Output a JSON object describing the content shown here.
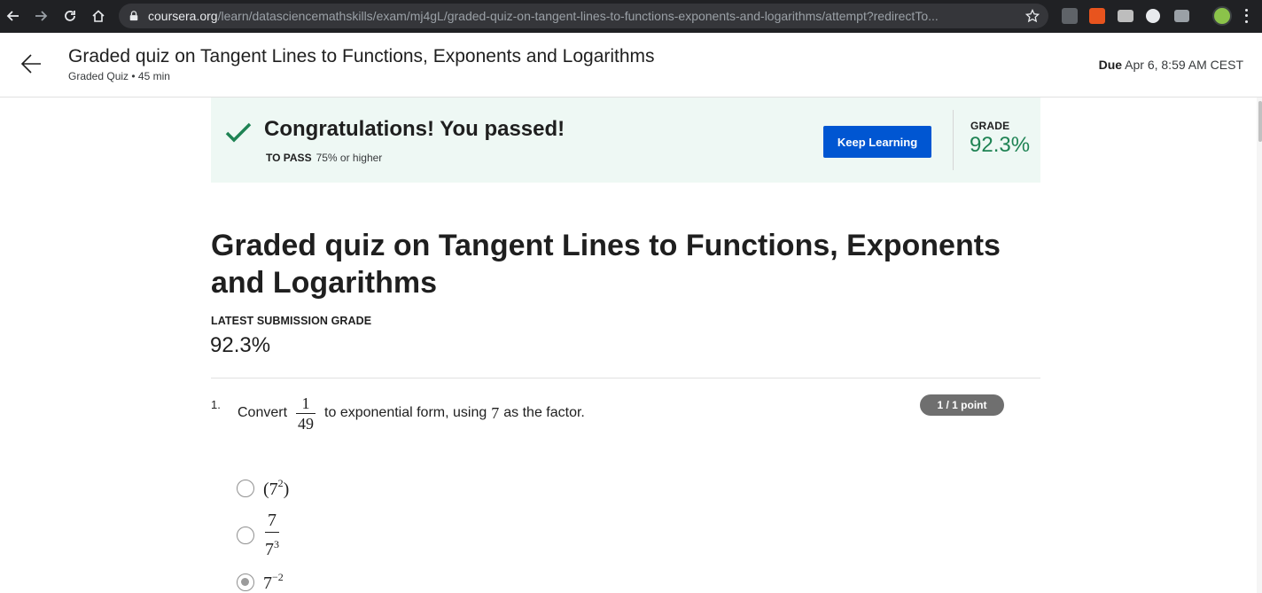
{
  "browser": {
    "url_host": "coursera.org",
    "url_path": "/learn/datasciencemathskills/exam/mj4gL/graded-quiz-on-tangent-lines-to-functions-exponents-and-logarithms/attempt?redirectTo..."
  },
  "header": {
    "title": "Graded quiz on Tangent Lines to Functions, Exponents and Logarithms",
    "subtitle": "Graded Quiz • 45 min",
    "due_label": "Due",
    "due_value": "Apr 6, 8:59 AM CEST"
  },
  "banner": {
    "message": "Congratulations! You passed!",
    "to_pass_label": "TO PASS",
    "to_pass_value": "75% or higher",
    "button_label": "Keep Learning",
    "grade_label": "GRADE",
    "grade_value": "92.3%",
    "colors": {
      "background": "#eef8f4",
      "success": "#1f8354",
      "button": "#0056d2"
    }
  },
  "quiz": {
    "title": "Graded quiz on Tangent Lines to Functions, Exponents and Logarithms",
    "latest_label": "LATEST SUBMISSION GRADE",
    "latest_value": "92.3%"
  },
  "question": {
    "number": "1.",
    "text_before": "Convert",
    "fraction_num": "1",
    "fraction_den": "49",
    "text_middle": "to exponential form, using",
    "factor": "7",
    "text_after": "as the factor.",
    "points": "1 / 1 point",
    "options": [
      {
        "base": "(7",
        "exp": "2",
        "close": ")",
        "selected": false
      },
      {
        "num": "7",
        "den_base": "7",
        "den_exp": "3",
        "selected": false
      },
      {
        "base": "7",
        "exp": "−2",
        "selected": true
      }
    ]
  },
  "icons": [
    "back-arrow-icon",
    "forward-arrow-icon",
    "reload-icon",
    "home-icon",
    "lock-icon",
    "star-icon",
    "check-icon"
  ]
}
